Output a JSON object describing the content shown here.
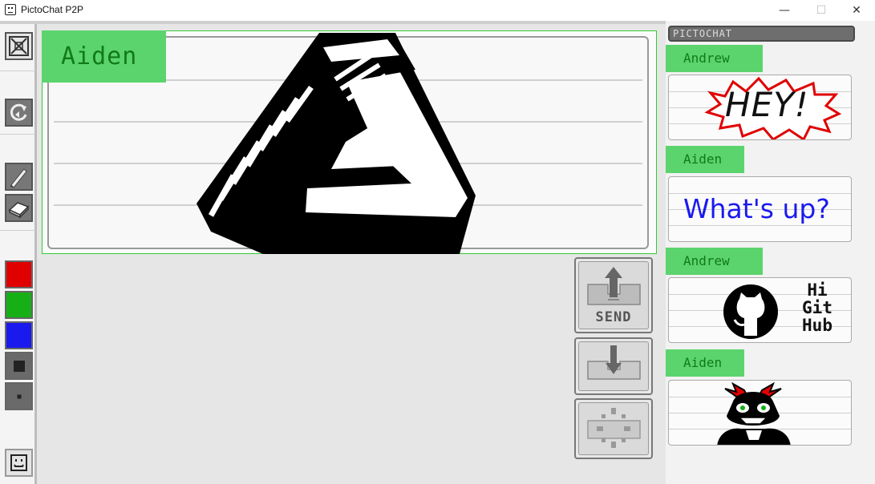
{
  "window": {
    "title": "PictoChat P2P",
    "controls": {
      "minimize": "—",
      "maximize": "☐",
      "close": "✕"
    }
  },
  "toolbar": {
    "tools": [
      "close-room-icon",
      "rotate-icon",
      "pencil-icon",
      "eraser-icon"
    ],
    "colors": [
      "#e00000",
      "#16b016",
      "#1a1aee"
    ],
    "pen_sizes": [
      "large",
      "small"
    ],
    "bottom_icon": "smiley-icon"
  },
  "canvas": {
    "author": "Aiden",
    "drawing": "impossible-triangle-drawing"
  },
  "actions": {
    "send_label": "SEND",
    "copy_icon": "copy-down-icon",
    "clear_icon": "clear-burst-icon"
  },
  "chat": {
    "header": "PICTOCHAT",
    "messages": [
      {
        "sender": "Andrew",
        "text": "HEY!"
      },
      {
        "sender": "Aiden",
        "text": "What's up?"
      },
      {
        "sender": "Andrew",
        "text": "Hi Git Hub"
      },
      {
        "sender": "Aiden",
        "text": ""
      }
    ]
  },
  "colors": {
    "name_tag_bg": "#5bd46d",
    "name_tag_text": "#117a1a",
    "canvas_border": "#33cc33"
  }
}
